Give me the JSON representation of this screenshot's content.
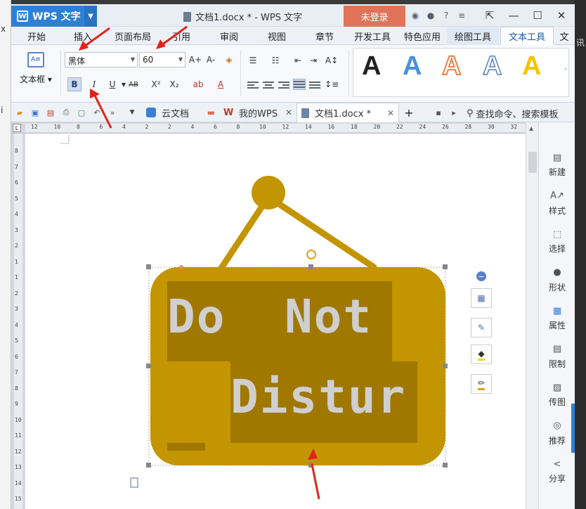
{
  "left_sliver": {
    "chars": [
      "x",
      "i"
    ]
  },
  "right_sliver": {
    "chars": [
      "讯"
    ]
  },
  "titlebar": {
    "app_name": "WPS 文字",
    "doc_title": "文档1.docx * - WPS 文字",
    "login_label": "未登录"
  },
  "ribbon_tabs": [
    {
      "label": "开始"
    },
    {
      "label": "插入"
    },
    {
      "label": "页面布局"
    },
    {
      "label": "引用"
    },
    {
      "label": "审阅"
    },
    {
      "label": "视图"
    },
    {
      "label": "章节"
    },
    {
      "label": "开发工具"
    },
    {
      "label": "特色应用"
    },
    {
      "label": "绘图工具"
    },
    {
      "label": "文本工具"
    },
    {
      "label": "文"
    }
  ],
  "ribbon": {
    "textbox_label": "文本框",
    "font_name": "黑体",
    "font_size": "60",
    "bold_label": "B",
    "italic_label": "I",
    "underline_label": "U",
    "grow_label": "A+",
    "shrink_label": "A-",
    "superscript_label": "X²",
    "subscript_label": "X₂",
    "art_letter": "A",
    "art_colors": {
      "black": "#000000",
      "blue": "#4a90d9",
      "orange": "#e8824a",
      "outline_blue": "#5a7fb8",
      "yellow": "#f5c400"
    }
  },
  "doc_tabs": [
    {
      "label": "云文档"
    },
    {
      "label": "我的WPS"
    },
    {
      "label": "文档1.docx *"
    }
  ],
  "search_cmd_label": "查找命令、搜索模板",
  "ruler": {
    "h_numbers": [
      "12",
      "10",
      "8",
      "6",
      "4",
      "2",
      "2",
      "4",
      "6",
      "8",
      "10",
      "12",
      "14",
      "16",
      "18",
      "20",
      "22",
      "24",
      "26",
      "28",
      "30",
      "32"
    ],
    "v_numbers": [
      "8",
      "7",
      "6",
      "5",
      "4",
      "3",
      "2",
      "1",
      "1",
      "2",
      "3",
      "4",
      "5",
      "6",
      "7",
      "8",
      "9",
      "10",
      "11",
      "12",
      "13",
      "14",
      "15"
    ]
  },
  "sign": {
    "line1": "Do  Not",
    "line2": "Distur",
    "colors": {
      "board": "#c39500",
      "dark": "#a07800",
      "text": "#cfcfcf"
    }
  },
  "taskpane": [
    {
      "label": "新建",
      "icon": "new-doc-icon"
    },
    {
      "label": "样式",
      "icon": "style-icon"
    },
    {
      "label": "选择",
      "icon": "select-icon"
    },
    {
      "label": "形状",
      "icon": "shape-icon"
    },
    {
      "label": "属性",
      "icon": "property-icon"
    },
    {
      "label": "限制",
      "icon": "restrict-icon"
    },
    {
      "label": "传图",
      "icon": "upload-image-icon"
    },
    {
      "label": "推荐",
      "icon": "recommend-icon"
    },
    {
      "label": "分享",
      "icon": "share-icon"
    }
  ]
}
